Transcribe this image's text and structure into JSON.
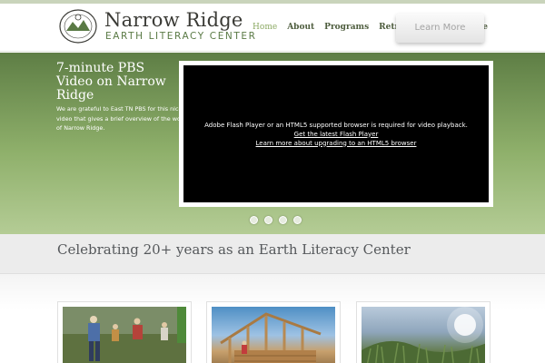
{
  "header": {
    "logo_name": "Narrow Ridge",
    "logo_tagline": "EARTH LITERACY CENTER",
    "nav": [
      {
        "label": "Home",
        "active": true
      },
      {
        "label": "About",
        "active": false
      },
      {
        "label": "Programs",
        "active": false
      },
      {
        "label": "Retreat Facilities",
        "active": false
      },
      {
        "label": "Give",
        "active": false
      }
    ]
  },
  "hero": {
    "title": "7-minute PBS Video on Narrow Ridge",
    "description": "We are grateful to East TN PBS for this nice video that gives a brief overview of the work of Narrow Ridge.",
    "video": {
      "message": "Adobe Flash Player or an HTML5 supported browser is required for video playback.",
      "link_flash": "Get the latest Flash Player",
      "link_html5": "Learn more about upgrading to an HTML5 browser"
    },
    "slide_count": 4
  },
  "banner": {
    "text": "Celebrating 20+ years as an Earth Literacy Center",
    "button_label": "Learn More"
  },
  "cards": [
    {
      "icon": "music-performers-photo"
    },
    {
      "icon": "cabin-construction-photo"
    },
    {
      "icon": "sun-over-field-photo"
    }
  ],
  "colors": {
    "brand_green": "#5a7a45",
    "nav_active": "#8aa861",
    "hero_top": "#5e7e45",
    "hero_bottom": "#b4cc95"
  }
}
